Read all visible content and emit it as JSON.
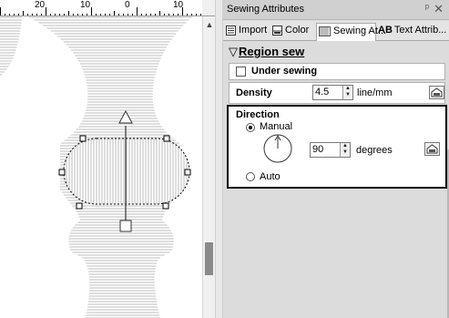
{
  "ruler": {
    "labels": [
      "20",
      "10",
      "0",
      "10"
    ]
  },
  "canvas": {
    "scroll_up_glyph": "▲"
  },
  "panel": {
    "title": "Sewing Attributes",
    "pin_glyph": "ᵖ",
    "close_glyph": "✕",
    "tabs": [
      {
        "label": "Import",
        "icon": "import-icon"
      },
      {
        "label": "Color",
        "icon": "color-icon"
      },
      {
        "label": "Sewing At...",
        "icon": "sewing-icon",
        "active": true
      },
      {
        "prefix": "AB",
        "label": "Text Attrib...",
        "icon": "text-icon"
      }
    ]
  },
  "region_sew": {
    "triangle": "▽",
    "label": "Region sew",
    "under_sewing_label": "Under sewing",
    "under_sewing_checked": false,
    "density_label": "Density",
    "density_value": "4.5",
    "density_unit": "line/mm"
  },
  "direction": {
    "label": "Direction",
    "manual_label": "Manual",
    "manual_selected": true,
    "angle_value": "90",
    "angle_unit": "degrees",
    "auto_label": "Auto",
    "auto_selected": false
  },
  "colors": {
    "stitch": "#c8c8c8",
    "panel_bg": "#dcdcdc",
    "highlight_border": "#000000"
  }
}
